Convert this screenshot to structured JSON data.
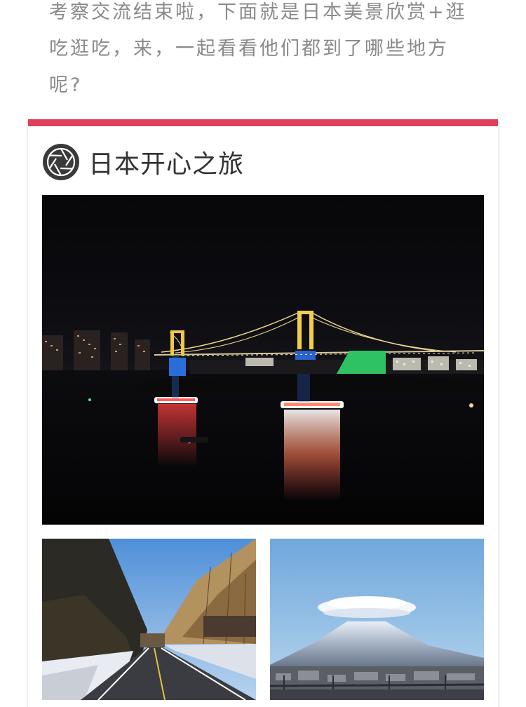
{
  "intro": {
    "line1": "考察交流结束啦，下面就是日本美景欣赏+逛",
    "line2": "吃逛吃，来，一起看看他们都到了哪些地方",
    "line3": "呢?"
  },
  "section": {
    "title": "日本开心之旅",
    "icon": "camera-aperture-icon",
    "accent_color": "#e0405a"
  },
  "photos": [
    {
      "name": "rainbow-bridge-night-photo"
    },
    {
      "name": "snowy-mountain-road-photo"
    },
    {
      "name": "mount-fuji-lenticular-cloud-photo"
    }
  ]
}
